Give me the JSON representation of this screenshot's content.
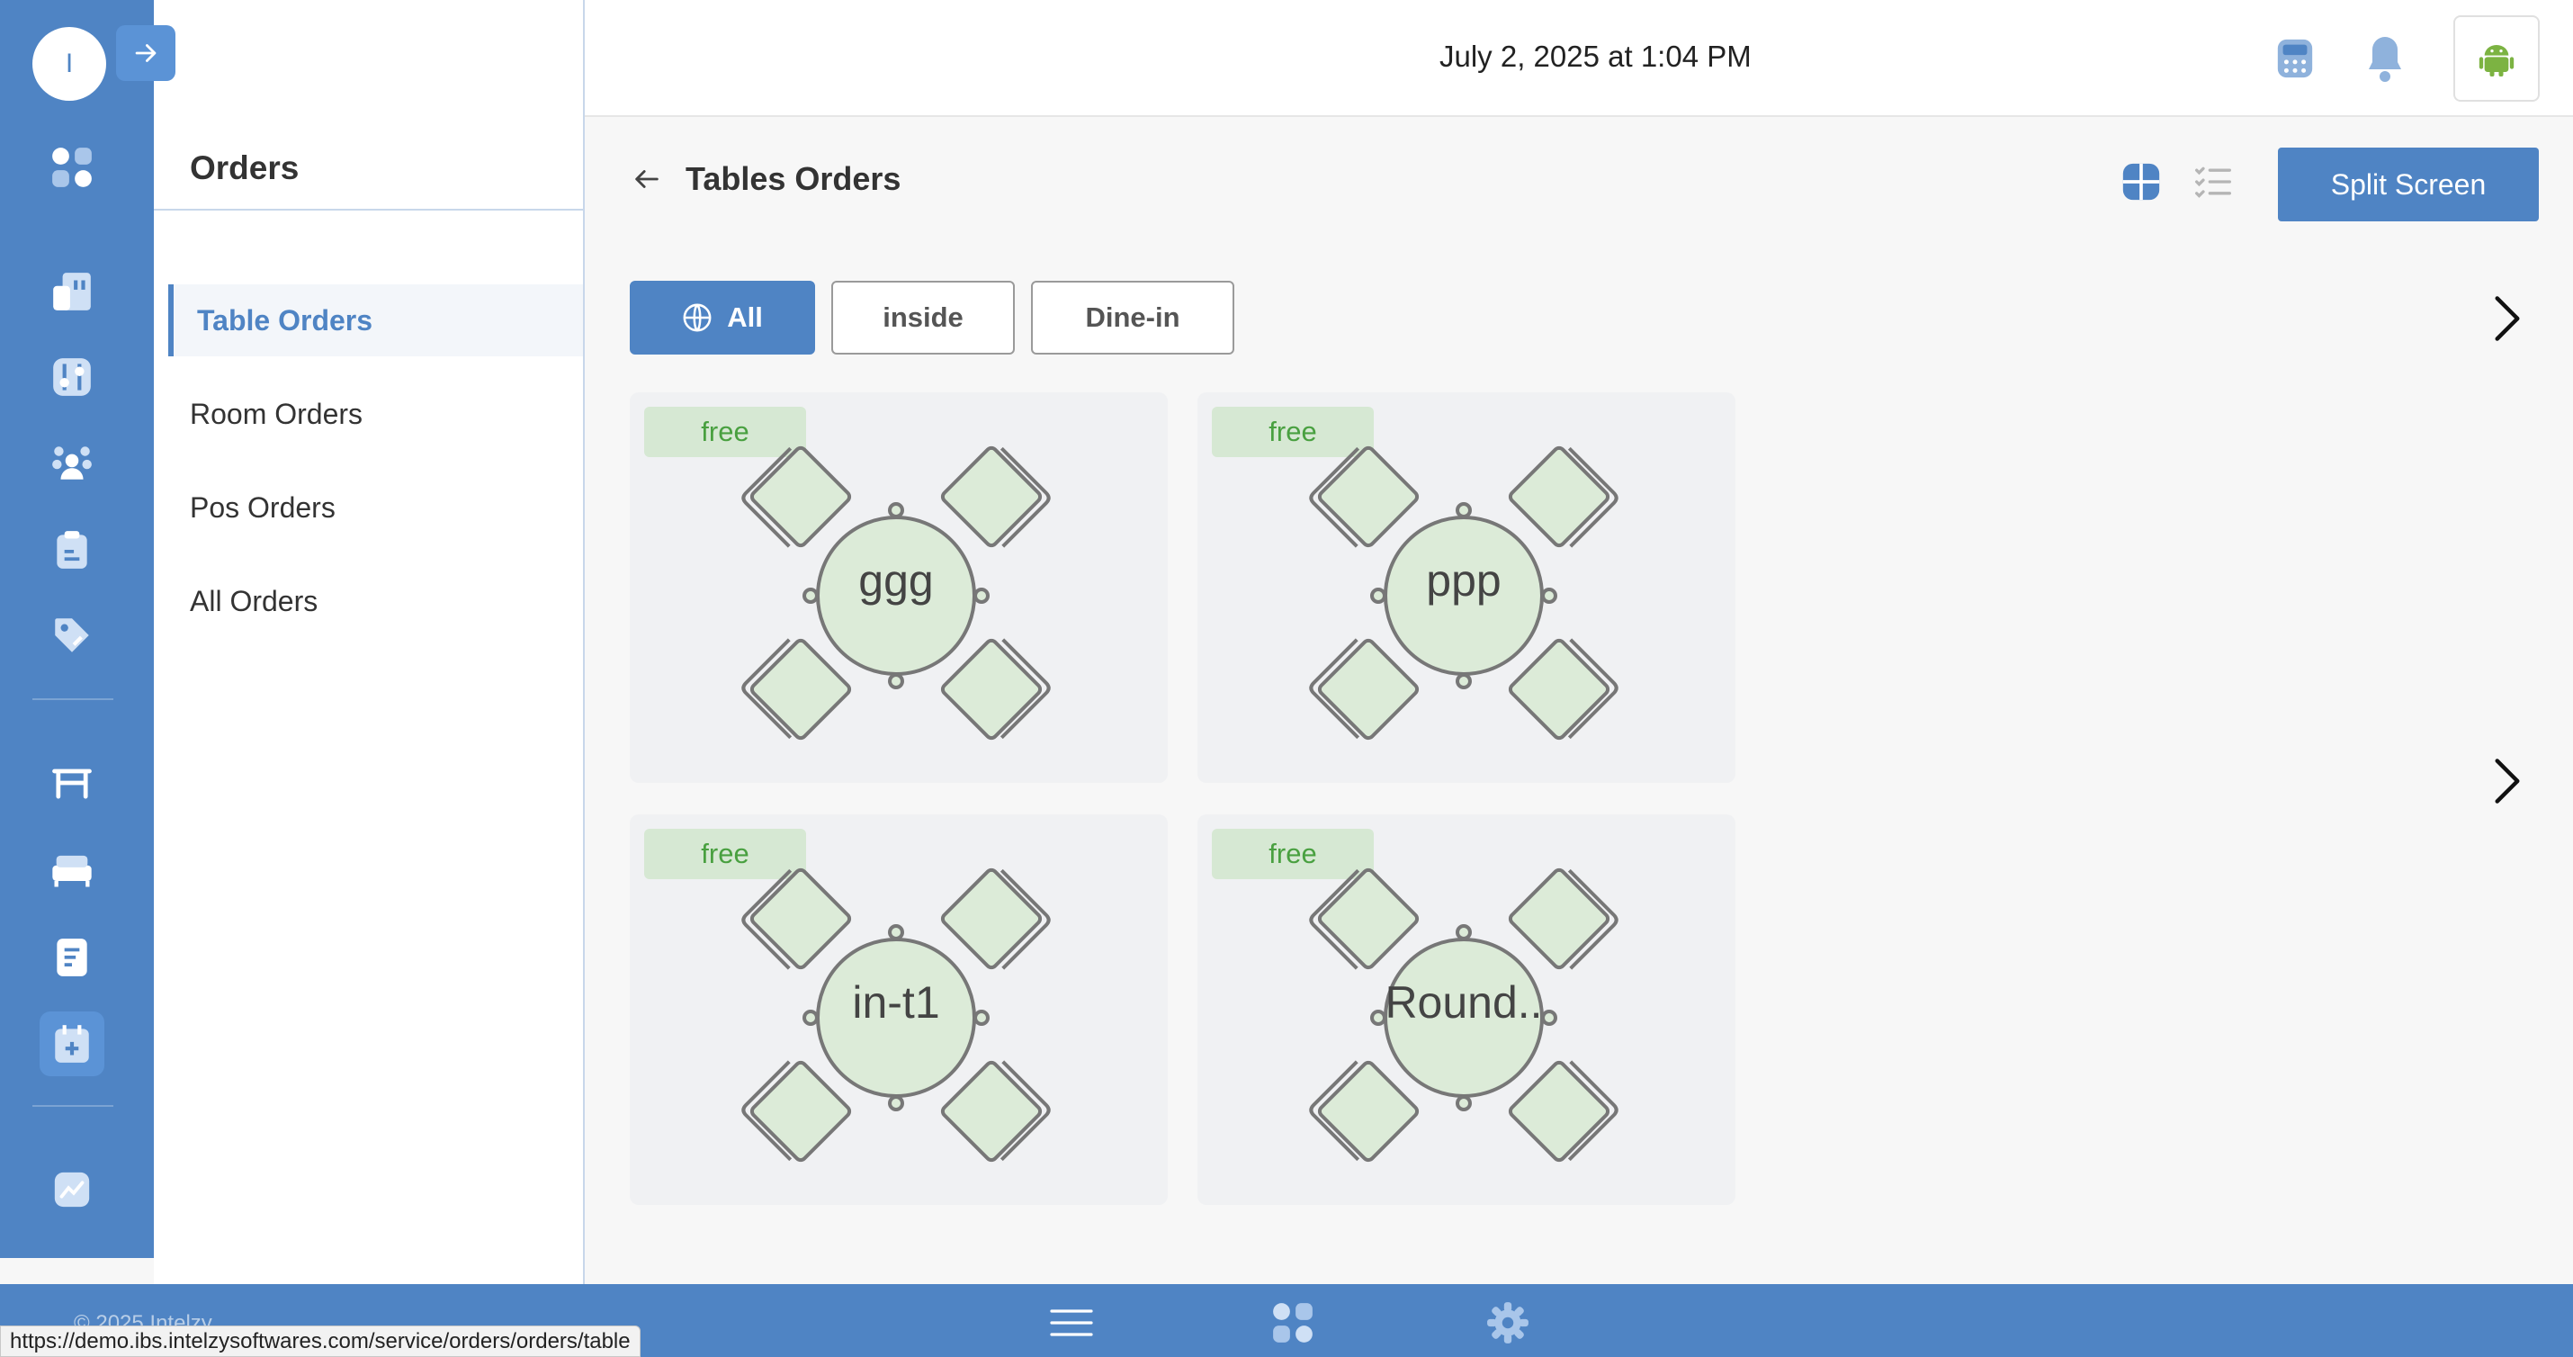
{
  "rail": {
    "avatar_letter": "I"
  },
  "subnav": {
    "title": "Orders",
    "items": [
      {
        "label": "Table Orders",
        "active": true
      },
      {
        "label": "Room Orders",
        "active": false
      },
      {
        "label": "Pos Orders",
        "active": false
      },
      {
        "label": "All Orders",
        "active": false
      }
    ]
  },
  "header": {
    "datetime": "July 2, 2025 at 1:04 PM"
  },
  "main": {
    "title": "Tables Orders",
    "split_label": "Split Screen",
    "filters": [
      {
        "label": "All",
        "active": true
      },
      {
        "label": "inside",
        "active": false
      },
      {
        "label": "Dine-in",
        "active": false
      }
    ],
    "tables": [
      {
        "name": "ggg",
        "status": "free"
      },
      {
        "name": "ppp",
        "status": "free"
      },
      {
        "name": "in-t1",
        "status": "free"
      },
      {
        "name": "Round..",
        "status": "free"
      }
    ]
  },
  "footer": {
    "copyright": "© 2025 Intelzy"
  },
  "statusbar": {
    "url": "https://demo.ibs.intelzysoftwares.com/service/orders/orders/table"
  },
  "colors": {
    "primary": "#4f84c4",
    "free_badge_bg": "#d6e8d3",
    "free_badge_text": "#49a040",
    "table_fill": "#dcebd8"
  }
}
